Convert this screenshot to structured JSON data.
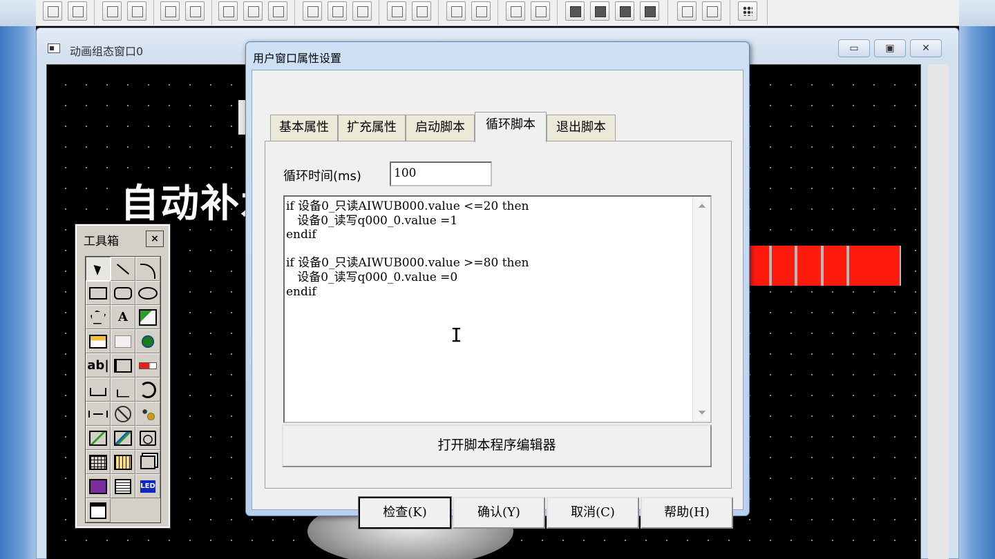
{
  "child_window": {
    "title": "动画组态窗口0",
    "controls": [
      "▭",
      "▣",
      "✕"
    ]
  },
  "scene": {
    "title_fragment": "自动补水"
  },
  "toolbox": {
    "title": "工具箱",
    "close": "×",
    "tools": [
      {
        "icon": "pointer-icon",
        "label": ""
      },
      {
        "icon": "line-icon",
        "label": ""
      },
      {
        "icon": "arc-icon",
        "label": ""
      },
      {
        "icon": "rectangle-icon",
        "label": ""
      },
      {
        "icon": "rounded-rectangle-icon",
        "label": ""
      },
      {
        "icon": "ellipse-icon",
        "label": ""
      },
      {
        "icon": "polygon-icon",
        "label": ""
      },
      {
        "icon": "text-icon",
        "label": "A"
      },
      {
        "icon": "picture-icon",
        "label": ""
      },
      {
        "icon": "standard-button-icon",
        "label": ""
      },
      {
        "icon": "push-button-icon",
        "label": ""
      },
      {
        "icon": "hotspot-icon",
        "label": ""
      },
      {
        "icon": "input-box-icon",
        "label": "ab|"
      },
      {
        "icon": "slider-input-icon",
        "label": ""
      },
      {
        "icon": "bar-meter-icon",
        "label": ""
      },
      {
        "icon": "flow-block-icon",
        "label": ""
      },
      {
        "icon": "pipe-icon",
        "label": ""
      },
      {
        "icon": "rotation-icon",
        "label": ""
      },
      {
        "icon": "valve-icon",
        "label": ""
      },
      {
        "icon": "gauge-icon",
        "label": ""
      },
      {
        "icon": "indicator-icon",
        "label": ""
      },
      {
        "icon": "trend-chart-icon",
        "label": ""
      },
      {
        "icon": "history-trend-icon",
        "label": ""
      },
      {
        "icon": "alarm-icon",
        "label": ""
      },
      {
        "icon": "table-icon",
        "label": ""
      },
      {
        "icon": "data-table-icon",
        "label": ""
      },
      {
        "icon": "window-stack-icon",
        "label": ""
      },
      {
        "icon": "curve-icon",
        "label": ""
      },
      {
        "icon": "form-icon",
        "label": ""
      },
      {
        "icon": "led-icon",
        "label": ""
      },
      {
        "icon": "animation-icon",
        "label": ""
      }
    ]
  },
  "dialog": {
    "title": "用户窗口属性设置",
    "tabs": [
      "基本属性",
      "扩充属性",
      "启动脚本",
      "循环脚本",
      "退出脚本"
    ],
    "active_tab": "循环脚本",
    "cycle_time_label": "循环时间(ms)",
    "cycle_time_value": "100",
    "script": "if 设备0_只读AIWUB000.value <=20 then\n   设备0_读写q000_0.value =1\nendif\n\nif 设备0_只读AIWUB000.value >=80 then\n   设备0_读写q000_0.value =0\nendif",
    "open_editor_label": "打开脚本程序编辑器",
    "buttons": {
      "check": "检查(K)",
      "confirm": "确认(Y)",
      "cancel": "取消(C)",
      "help": "帮助(H)"
    }
  },
  "colors": {
    "canvas": "#000000",
    "indicator_red": "#ff1a0e",
    "dialog_frame": "#b8d0ec"
  }
}
